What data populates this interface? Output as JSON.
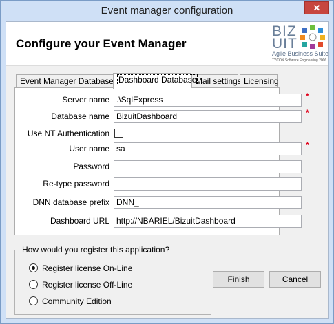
{
  "window": {
    "title": "Event manager configuration",
    "close_glyph": "✕"
  },
  "header": {
    "title": "Configure your Event Manager",
    "logo": {
      "line1": "BIZ",
      "line2": "UIT",
      "subtitle": "Agile Business Suite",
      "fine_print": "TYCON Software Engineering 2006"
    }
  },
  "tabs": [
    {
      "label": "Event Manager Database",
      "active": false
    },
    {
      "label": "Dashboard Database",
      "active": true
    },
    {
      "label": "Mail settings",
      "active": false
    },
    {
      "label": "Licensing",
      "active": false
    }
  ],
  "form": {
    "server_name": {
      "label": "Server name",
      "value": ".\\SqlExpress",
      "required": true
    },
    "database_name": {
      "label": "Database name",
      "value": "BizuitDashboard",
      "required": true
    },
    "nt_auth": {
      "label": "Use NT Authentication",
      "checked": false
    },
    "user_name": {
      "label": "User name",
      "value": "sa",
      "required": true
    },
    "password": {
      "label": "Password",
      "value": ""
    },
    "retype_password": {
      "label": "Re-type password",
      "value": ""
    },
    "dnn_prefix": {
      "label": "DNN database prefix",
      "value": "DNN_"
    },
    "dashboard_url": {
      "label": "Dashboard URL",
      "value": "http://NBARIEL/BizuitDashboard"
    },
    "required_marker": "*"
  },
  "registration": {
    "title": "How would you register this application?",
    "options": [
      {
        "label": "Register license On-Line",
        "selected": true
      },
      {
        "label": "Register license Off-Line",
        "selected": false
      },
      {
        "label": "Community Edition",
        "selected": false
      }
    ]
  },
  "buttons": {
    "finish": "Finish",
    "cancel": "Cancel"
  },
  "colors": {
    "frame": "#cfe0f6",
    "close_button": "#c7463f",
    "required": "#e0001a"
  }
}
